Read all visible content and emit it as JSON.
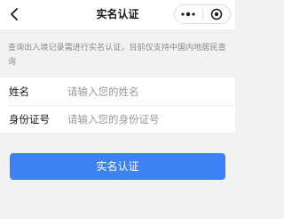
{
  "nav": {
    "title": "实名认证",
    "back_icon": "chevron-left-icon",
    "more_icon": "more-dots-icon",
    "close_icon": "target-close-icon"
  },
  "notice": {
    "text": "查询出入境记录需进行实名认证，目前仅支持中国内地居民查询"
  },
  "form": {
    "name": {
      "label": "姓名",
      "placeholder": "请输入您的姓名",
      "value": ""
    },
    "id_number": {
      "label": "身份证号",
      "placeholder": "请输入您的身份证号",
      "value": ""
    }
  },
  "submit": {
    "label": "实名认证"
  },
  "colors": {
    "primary": "#3d82f5",
    "background": "#f2f2f2",
    "hint_text": "#8a8a8a"
  }
}
